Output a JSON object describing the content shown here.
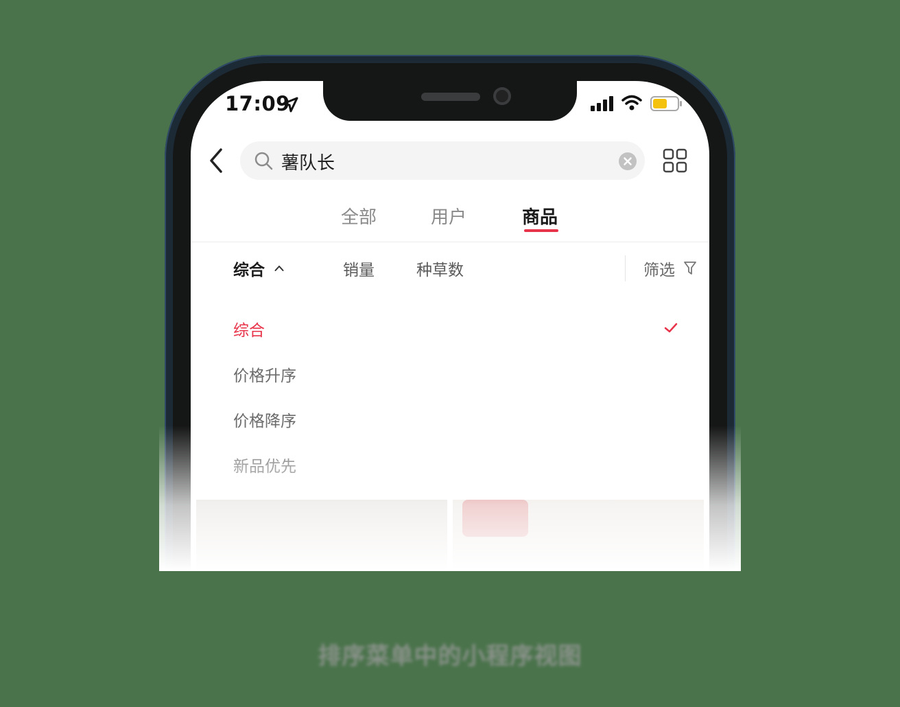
{
  "status_bar": {
    "time": "17:09"
  },
  "search": {
    "query": "薯队长"
  },
  "tabs": [
    {
      "label": "全部",
      "active": false
    },
    {
      "label": "用户",
      "active": false
    },
    {
      "label": "商品",
      "active": true
    }
  ],
  "sort_bar": {
    "items": [
      "综合",
      "销量",
      "种草数"
    ],
    "active": "综合",
    "filter_label": "筛选"
  },
  "sort_options": [
    {
      "label": "综合",
      "selected": true
    },
    {
      "label": "价格升序",
      "selected": false
    },
    {
      "label": "价格降序",
      "selected": false
    },
    {
      "label": "新品优先",
      "selected": false
    }
  ],
  "caption": "排序菜单中的小程序视图",
  "colors": {
    "accent": "#e8344a",
    "background": "#4a734b",
    "battery": "#f4c20d"
  },
  "icons": [
    "back-icon",
    "search-icon",
    "clear-icon",
    "grid-icon",
    "caret-up-icon",
    "filter-icon",
    "check-icon",
    "location-icon",
    "signal-icon",
    "wifi-icon",
    "battery-icon"
  ]
}
